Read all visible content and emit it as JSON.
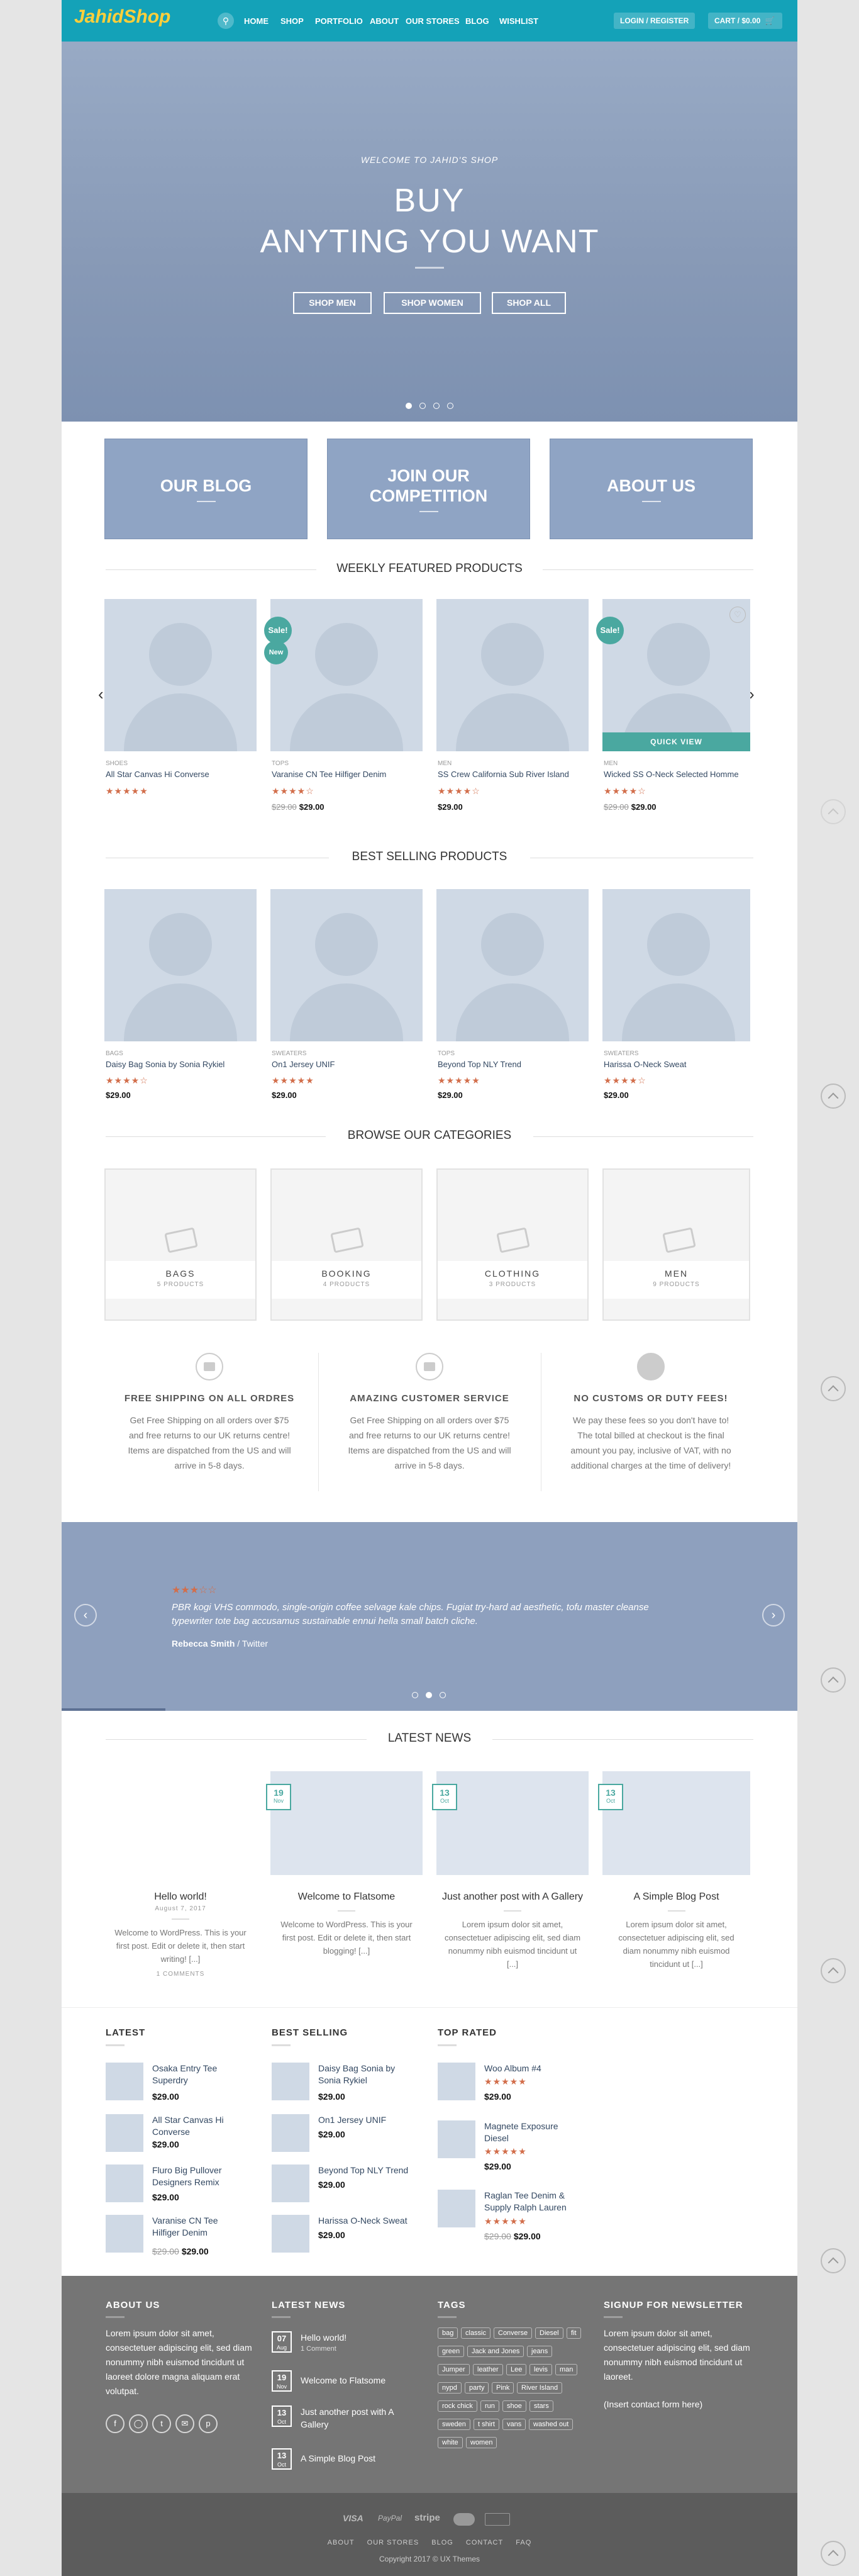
{
  "header": {
    "logo": "JahidShop",
    "nav": [
      "HOME",
      "SHOP",
      "PORTFOLIO",
      "ABOUT",
      "OUR STORES",
      "BLOG",
      "WISHLIST"
    ],
    "login": "LOGIN / REGISTER",
    "cart": "CART / $0.00"
  },
  "hero": {
    "welcome": "WELCOME TO JAHID'S SHOP",
    "title1": "BUY",
    "title2": "ANYTING YOU WANT",
    "buttons": [
      "SHOP MEN",
      "SHOP WOMEN",
      "SHOP ALL"
    ]
  },
  "promos": [
    "OUR BLOG",
    "JOIN OUR COMPETITION",
    "ABOUT US"
  ],
  "featured": {
    "title": "WEEKLY FEATURED PRODUCTS",
    "quick_view": "QUICK VIEW",
    "products": [
      {
        "cat": "SHOES",
        "name": "All Star Canvas Hi Converse",
        "rating": 4.5,
        "stars": "★★★★★",
        "old": "",
        "price": "",
        "badges": []
      },
      {
        "cat": "TOPS",
        "name": "Varanise CN Tee Hilfiger Denim",
        "rating": 4,
        "stars": "★★★★☆",
        "old": "$29.00",
        "price": "$29.00",
        "badges": [
          "Sale!",
          "New"
        ]
      },
      {
        "cat": "MEN",
        "name": "SS Crew California Sub River Island",
        "rating": 4,
        "stars": "★★★★☆",
        "old": "",
        "price": "$29.00",
        "badges": []
      },
      {
        "cat": "MEN",
        "name": "Wicked SS O-Neck Selected Homme",
        "rating": 4,
        "stars": "★★★★☆",
        "old": "$29.00",
        "price": "$29.00",
        "badges": [
          "Sale!"
        ]
      }
    ]
  },
  "bestselling": {
    "title": "BEST SELLING PRODUCTS",
    "products": [
      {
        "cat": "BAGS",
        "name": "Daisy Bag Sonia by Sonia Rykiel",
        "rating": 4,
        "stars": "★★★★☆",
        "price": "$29.00"
      },
      {
        "cat": "SWEATERS",
        "name": "On1 Jersey UNIF",
        "rating": 5,
        "stars": "★★★★★",
        "price": "$29.00"
      },
      {
        "cat": "TOPS",
        "name": "Beyond Top NLY Trend",
        "rating": 5,
        "stars": "★★★★★",
        "price": "$29.00"
      },
      {
        "cat": "SWEATERS",
        "name": "Harissa O-Neck Sweat",
        "rating": 4,
        "stars": "★★★★☆",
        "price": "$29.00"
      }
    ]
  },
  "categories": {
    "title": "BROWSE OUR CATEGORIES",
    "items": [
      {
        "name": "BAGS",
        "count": "5 PRODUCTS"
      },
      {
        "name": "BOOKING",
        "count": "4 PRODUCTS"
      },
      {
        "name": "CLOTHING",
        "count": "3 PRODUCTS"
      },
      {
        "name": "MEN",
        "count": "9 PRODUCTS"
      }
    ]
  },
  "features": [
    {
      "title": "FREE SHIPPING ON ALL ORDRES",
      "text": "Get Free Shipping on all orders over $75 and free returns to our UK returns centre! Items are dispatched from the US and will arrive in 5-8 days."
    },
    {
      "title": "AMAZING CUSTOMER SERVICE",
      "text": "Get Free Shipping on all orders over $75 and free returns to our UK returns centre! Items are dispatched from the US and will arrive in 5-8 days."
    },
    {
      "title": "NO CUSTOMS OR DUTY FEES!",
      "text": "We pay these fees so you don't have to! The total billed at checkout is the final amount you pay, inclusive of VAT, with no additional charges at the time of delivery!"
    }
  ],
  "testimonial": {
    "stars": "★★★☆☆",
    "rating": 3,
    "quote": "PBR kogi VHS commodo, single-origin coffee selvage kale chips. Fugiat try-hard ad aesthetic, tofu master cleanse typewriter tote bag accusamus sustainable ennui hella small batch cliche.",
    "author": "Rebecca Smith",
    "source": "Twitter"
  },
  "news": {
    "title": "LATEST NEWS",
    "posts": [
      {
        "title": "Hello world!",
        "date": "August 7, 2017",
        "day": "",
        "mon": "",
        "text": "Welcome to WordPress. This is your first post. Edit or delete it, then start writing! [...]",
        "comments": "1 COMMENTS"
      },
      {
        "title": "Welcome to Flatsome",
        "day": "19",
        "mon": "Nov",
        "text": "Welcome to WordPress. This is your first post. Edit or delete it, then start blogging! [...]"
      },
      {
        "title": "Just another post with A Gallery",
        "day": "13",
        "mon": "Oct",
        "text": "Lorem ipsum dolor sit amet, consectetuer adipiscing elit, sed diam nonummy nibh euismod tincidunt ut [...]"
      },
      {
        "title": "A Simple Blog Post",
        "day": "13",
        "mon": "Oct",
        "text": "Lorem ipsum dolor sit amet, consectetuer adipiscing elit, sed diam nonummy nibh euismod tincidunt ut [...]"
      }
    ]
  },
  "widgets": {
    "latest": {
      "title": "LATEST",
      "items": [
        {
          "name": "Osaka Entry Tee Superdry",
          "price": "$29.00"
        },
        {
          "name": "All Star Canvas Hi Converse",
          "price": "$29.00"
        },
        {
          "name": "Fluro Big Pullover Designers Remix",
          "price": "$29.00"
        },
        {
          "name": "Varanise CN Tee Hilfiger Denim",
          "old": "$29.00",
          "price": "$29.00"
        }
      ]
    },
    "best": {
      "title": "BEST SELLING",
      "items": [
        {
          "name": "Daisy Bag Sonia by Sonia Rykiel",
          "price": "$29.00"
        },
        {
          "name": "On1 Jersey UNIF",
          "price": "$29.00"
        },
        {
          "name": "Beyond Top NLY Trend",
          "price": "$29.00"
        },
        {
          "name": "Harissa O-Neck Sweat",
          "price": "$29.00"
        }
      ]
    },
    "top": {
      "title": "TOP RATED",
      "items": [
        {
          "name": "Woo Album #4",
          "stars": "★★★★★",
          "price": "$29.00"
        },
        {
          "name": "Magnete Exposure Diesel",
          "stars": "★★★★★",
          "price": "$29.00"
        },
        {
          "name": "Raglan Tee Denim & Supply Ralph Lauren",
          "stars": "★★★★★",
          "old": "$29.00",
          "price": "$29.00"
        }
      ]
    }
  },
  "footer": {
    "about": {
      "title": "ABOUT US",
      "text": "Lorem ipsum dolor sit amet, consectetuer adipiscing elit, sed diam nonummy nibh euismod tincidunt ut laoreet dolore magna aliquam erat volutpat."
    },
    "latest_news": {
      "title": "LATEST NEWS",
      "items": [
        {
          "day": "07",
          "mon": "Aug",
          "title": "Hello world!",
          "sub": "1 Comment"
        },
        {
          "day": "19",
          "mon": "Nov",
          "title": "Welcome to Flatsome"
        },
        {
          "day": "13",
          "mon": "Oct",
          "title": "Just another post with A Gallery"
        },
        {
          "day": "13",
          "mon": "Oct",
          "title": "A Simple Blog Post"
        }
      ]
    },
    "tags": {
      "title": "TAGS",
      "items": [
        "bag",
        "classic",
        "Converse",
        "Diesel",
        "fit",
        "green",
        "Jack and Jones",
        "jeans",
        "Jumper",
        "leather",
        "Lee",
        "levis",
        "man",
        "nypd",
        "party",
        "Pink",
        "River Island",
        "rock chick",
        "run",
        "shoe",
        "stars",
        "sweden",
        "t shirt",
        "vans",
        "washed out",
        "white",
        "women"
      ]
    },
    "newsletter": {
      "title": "SIGNUP FOR NEWSLETTER",
      "text": "Lorem ipsum dolor sit amet, consectetuer adipiscing elit, sed diam nonummy nibh euismod tincidunt ut laoreet.",
      "form": "(Insert contact form here)"
    },
    "payments": [
      "VISA",
      "PayPal",
      "stripe",
      "MC",
      "AMEX"
    ],
    "links": [
      "ABOUT",
      "OUR STORES",
      "BLOG",
      "CONTACT",
      "FAQ"
    ],
    "copyright": "Copyright 2017 © UX Themes"
  },
  "colors": {
    "accent": "#14a2b8",
    "sale": "#4aa8a0",
    "star": "#d26e4b",
    "footer": "#757575"
  }
}
